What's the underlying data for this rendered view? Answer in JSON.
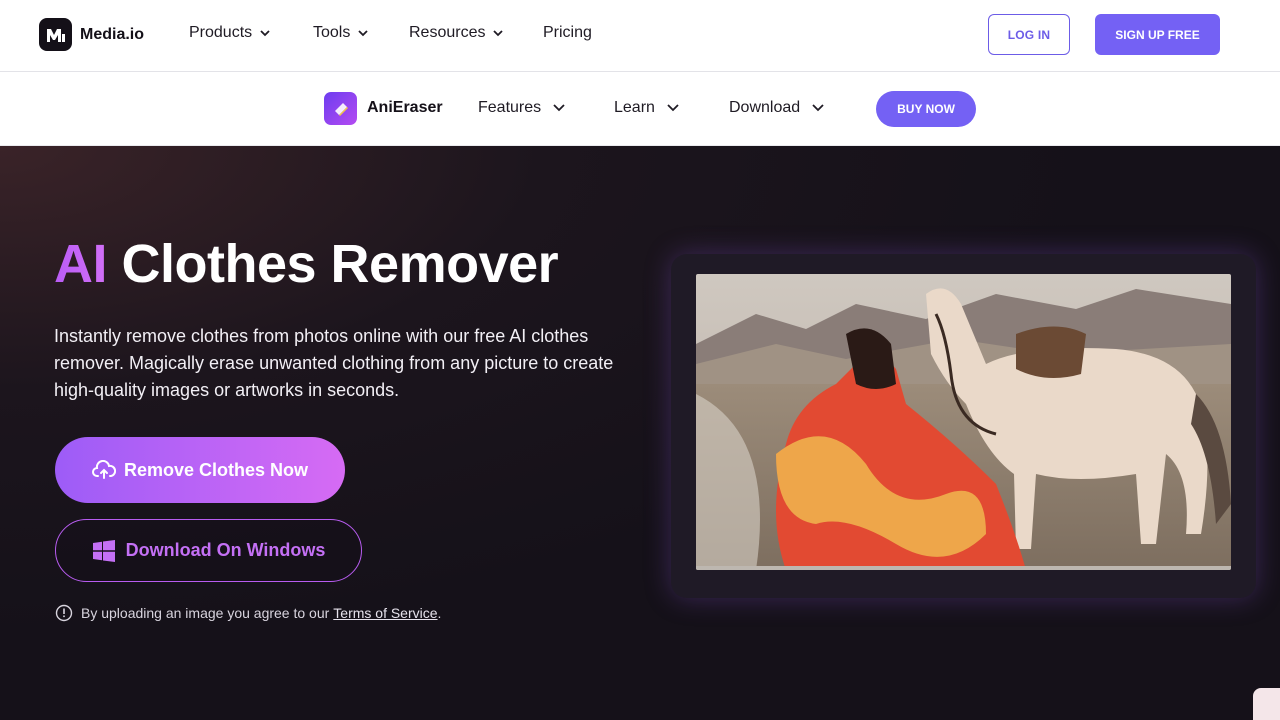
{
  "topnav": {
    "brand": "Media.io",
    "menu": [
      {
        "label": "Products"
      },
      {
        "label": "Tools"
      },
      {
        "label": "Resources"
      },
      {
        "label": "Pricing"
      }
    ],
    "login_label": "LOG IN",
    "signup_label": "SIGN UP FREE"
  },
  "subnav": {
    "product_name": "AniEraser",
    "menu": [
      {
        "label": "Features"
      },
      {
        "label": "Learn"
      },
      {
        "label": "Download"
      }
    ],
    "buy_label": "BUY NOW"
  },
  "hero": {
    "title_accent": "AI",
    "title_rest": "Clothes Remover",
    "description": "Instantly remove clothes from photos online with our free AI clothes remover. Magically erase unwanted clothing from any picture to create high-quality images or artworks in seconds.",
    "primary_button": "Remove Clothes Now",
    "secondary_button": "Download On Windows",
    "terms_text": "By uploading an image you agree to our",
    "terms_link": "Terms of Service",
    "terms_end": "."
  },
  "colors": {
    "brand_purple": "#7461f4",
    "accent_pink": "#d66bf4",
    "hero_bg": "#151119"
  },
  "icons": [
    "media-io-logo-icon",
    "chevron-down-icon",
    "anieraser-logo-icon",
    "cloud-upload-icon",
    "windows-icon",
    "info-icon"
  ]
}
